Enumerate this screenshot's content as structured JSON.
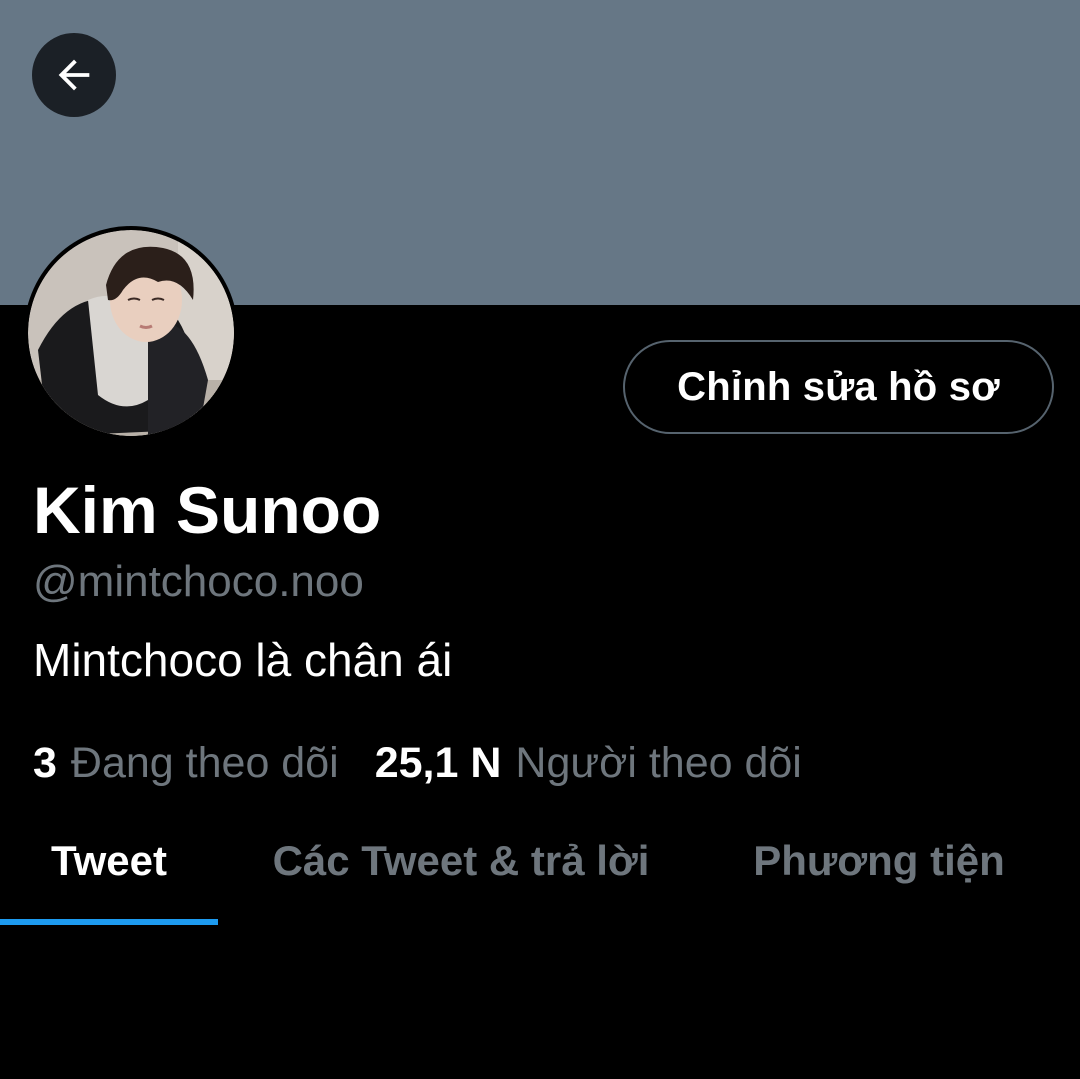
{
  "header": {
    "banner_color": "#667786",
    "back_button": {
      "icon": "arrow-left-icon",
      "label": ""
    }
  },
  "profile": {
    "avatar": {
      "icon": "profile-photo"
    },
    "edit_button_label": "Chỉnh sửa hồ sơ",
    "display_name": "Kim Sunoo",
    "handle": "@mintchoco.noo",
    "bio": "Mintchoco là chân ái",
    "stats": {
      "following": {
        "count": "3",
        "label": "Đang theo dõi"
      },
      "followers": {
        "count": "25,1 N",
        "label": "Người theo dõi"
      }
    }
  },
  "tabs": [
    {
      "label": "Tweet",
      "active": true
    },
    {
      "label": "Các Tweet & trả lời",
      "active": false
    },
    {
      "label": "Phương tiện",
      "active": false
    }
  ],
  "colors": {
    "background": "#000000",
    "accent": "#1d9bf0",
    "muted_text": "#6e767d",
    "primary_text": "#ffffff"
  }
}
